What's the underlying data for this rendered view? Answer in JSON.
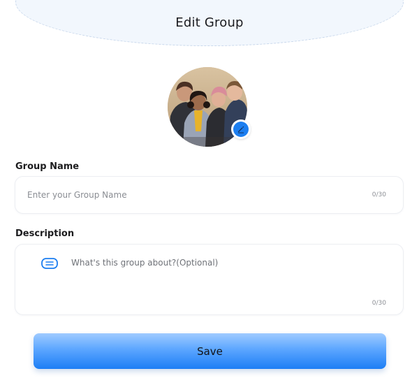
{
  "header": {
    "title": "Edit Group"
  },
  "avatar": {
    "edit_icon": "pencil-icon"
  },
  "group_name": {
    "label": "Group Name",
    "value": "",
    "placeholder": "Enter your Group Name",
    "counter": "0/30"
  },
  "description": {
    "label": "Description",
    "icon": "message-lines-icon",
    "value": "",
    "placeholder": "What's this group about?(Optional)",
    "counter": "0/30"
  },
  "save": {
    "label": "Save"
  },
  "colors": {
    "accent": "#1c7ef0",
    "header_bg": "#f2f7fd"
  }
}
